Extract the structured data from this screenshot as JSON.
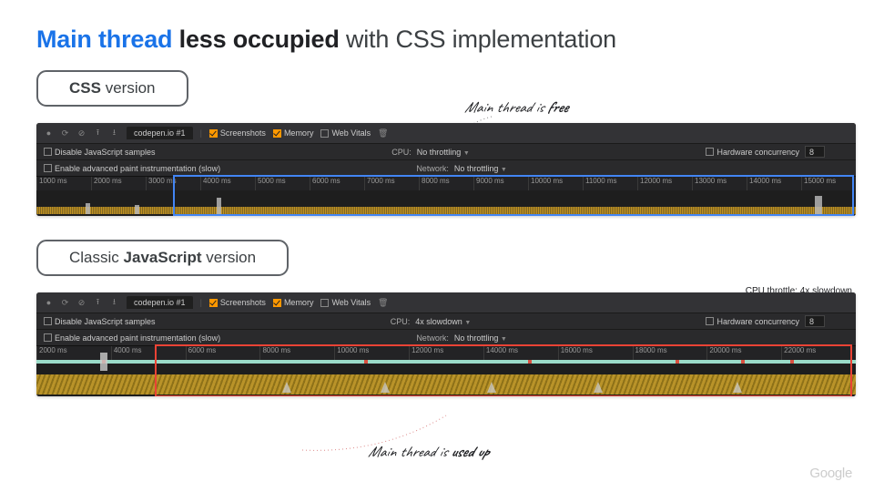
{
  "title": {
    "part1": "Main thread",
    "part2": "less occupied",
    "part3": "with CSS implementation"
  },
  "pill_css": {
    "a": "CSS",
    "b": "version"
  },
  "pill_js": {
    "a": "Classic",
    "b": "JavaScript",
    "c": "version"
  },
  "throttle": "CPU throttle: 4x slowdown",
  "ann_free": {
    "a": "Main thread is",
    "b": "free"
  },
  "ann_used": {
    "a": "Main thread is",
    "b": "used up"
  },
  "toolbar": {
    "tab": "codepen.io #1",
    "screenshots": "Screenshots",
    "memory": "Memory",
    "webvitals": "Web Vitals",
    "disable_js": "Disable JavaScript samples",
    "advanced_paint": "Enable advanced paint instrumentation (slow)",
    "cpu": "CPU:",
    "cpu_val_none": "No throttling",
    "cpu_val_4x": "4x slowdown",
    "network": "Network:",
    "network_val": "No throttling",
    "hardware": "Hardware concurrency",
    "hardware_val": "8"
  },
  "ticks_css": [
    "1000 ms",
    "2000 ms",
    "3000 ms",
    "4000 ms",
    "5000 ms",
    "6000 ms",
    "7000 ms",
    "8000 ms",
    "9000 ms",
    "10000 ms",
    "11000 ms",
    "12000 ms",
    "13000 ms",
    "14000 ms",
    "15000 ms"
  ],
  "ticks_js": [
    "2000 ms",
    "4000 ms",
    "6000 ms",
    "8000 ms",
    "10000 ms",
    "12000 ms",
    "14000 ms",
    "16000 ms",
    "18000 ms",
    "20000 ms",
    "22000 ms"
  ],
  "logo": "Google"
}
